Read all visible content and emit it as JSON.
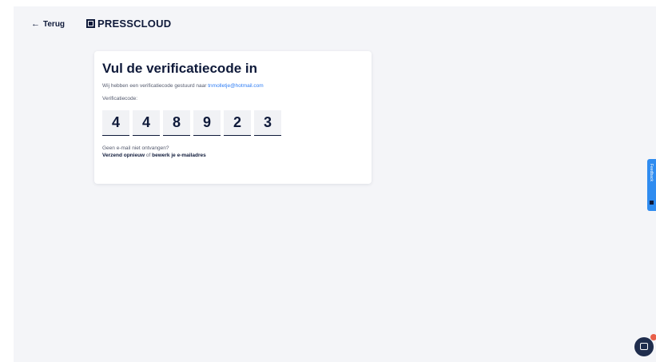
{
  "header": {
    "back_label": "Terug",
    "back_arrow": "←",
    "logo_text": "PRESSCLOUD"
  },
  "card": {
    "title": "Vul de verificatiecode in",
    "subtitle_prefix": "Wij hebben een verificatiecode gestuurd naar ",
    "email": "tnmolletje@hotmail.com",
    "code_label": "Verificatiecode:",
    "code_digits": [
      "4",
      "4",
      "8",
      "9",
      "2",
      "3"
    ],
    "no_mail_text": "Geen e-mail niet ontvangen?",
    "resend_label": "Verzend opnieuw",
    "or_text": " of ",
    "edit_email_label": "bewerk je e-mailadres"
  },
  "widgets": {
    "feedback_label": "Feedback"
  },
  "colors": {
    "accent": "#2f7ef5",
    "navy": "#0f1a3a",
    "background": "#f4f5f8",
    "feedback": "#2f8cf0",
    "badge": "#e8604a"
  },
  "icons": {
    "back": "arrow-left-icon",
    "logo": "presscloud-logo-icon",
    "chat": "chat-bubble-icon"
  }
}
